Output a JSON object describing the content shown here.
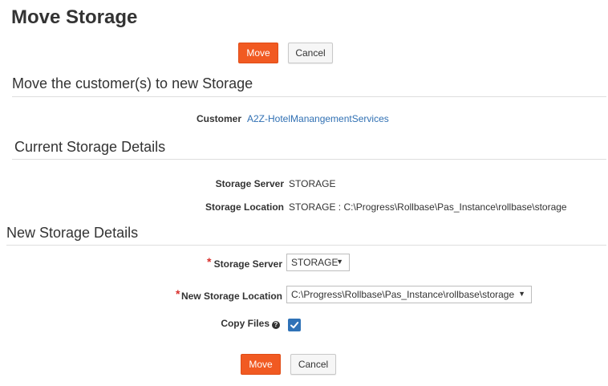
{
  "page": {
    "title": "Move Storage"
  },
  "top_actions": {
    "move_label": "Move",
    "cancel_label": "Cancel"
  },
  "move_section": {
    "title": "Move the customer(s) to new Storage",
    "customer_label": "Customer",
    "customer_value": "A2Z-HotelManangementServices"
  },
  "current_storage": {
    "title": "Current Storage Details",
    "server_label": "Storage Server",
    "server_value": "STORAGE",
    "location_label": "Storage Location",
    "location_value": "STORAGE : C:\\Progress\\Rollbase\\Pas_Instance\\rollbase\\storage"
  },
  "new_storage": {
    "title": "New Storage Details",
    "server_label": "Storage Server",
    "server_selected": "STORAGE",
    "location_label": "New Storage Location",
    "location_selected": "C:\\Progress\\Rollbase\\Pas_Instance\\rollbase\\storage",
    "copy_files_label": "Copy Files",
    "copy_files_checked": true,
    "required_mark": "*"
  },
  "bottom_actions": {
    "move_label": "Move",
    "cancel_label": "Cancel"
  },
  "colors": {
    "primary": "#f15a22",
    "link": "#3070b3",
    "required": "#d9302c",
    "checkbox": "#2f72b7"
  },
  "icons": {
    "help": "help-icon",
    "check": "check-icon",
    "dropdown": "chevron-down-icon"
  }
}
